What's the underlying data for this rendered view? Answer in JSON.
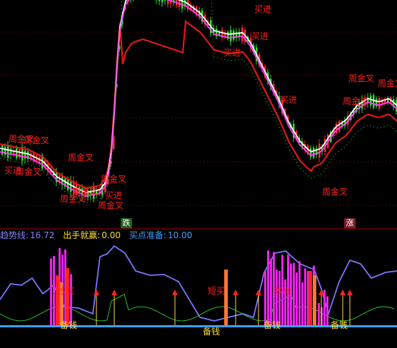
{
  "markers": {
    "down": "跌",
    "up": "涨"
  },
  "main_labels": [
    {
      "text": "周金叉",
      "cls": "sig-red",
      "id": "label-wk-cross-1"
    },
    {
      "text": "周金叉",
      "cls": "sig-red",
      "id": "label-wk-cross-2"
    },
    {
      "text": "买进",
      "cls": "sig-red",
      "id": "label-buy-1"
    },
    {
      "text": "周金叉",
      "cls": "sig-red",
      "id": "label-wk-cross-3"
    },
    {
      "text": "周金叉",
      "cls": "sig-red",
      "id": "label-wk-cross-4"
    },
    {
      "text": "周金叉",
      "cls": "sig-red",
      "id": "label-wk-cross-5"
    },
    {
      "text": "周金叉",
      "cls": "sig-red",
      "id": "label-wk-cross-6"
    },
    {
      "text": "周金叉",
      "cls": "sig-red",
      "id": "label-wk-cross-7"
    },
    {
      "text": "买进",
      "cls": "sig-red",
      "id": "label-buy-2"
    },
    {
      "text": "周金叉",
      "cls": "sig-red",
      "id": "label-wk-cross-8"
    },
    {
      "text": "买进",
      "cls": "sig-red",
      "id": "label-buy-3"
    },
    {
      "text": "买进",
      "cls": "sig-red",
      "id": "label-buy-4"
    },
    {
      "text": "买进",
      "cls": "sig-red",
      "id": "label-buy-5"
    },
    {
      "text": "买进",
      "cls": "sig-red",
      "id": "label-buy-6"
    },
    {
      "text": "周金叉",
      "cls": "sig-red",
      "id": "label-wk-cross-9"
    },
    {
      "text": "周金叉",
      "cls": "sig-red",
      "id": "label-wk-cross-10"
    },
    {
      "text": "周金叉",
      "cls": "sig-red",
      "id": "label-wk-cross-11"
    },
    {
      "text": "周金叉",
      "cls": "sig-red",
      "id": "label-wk-cross-12"
    }
  ],
  "indicator": {
    "name": "趋势线:",
    "trend_value": "16.72",
    "exit_label": "出手就赢:",
    "exit_value": "0.00",
    "prep_label": "买点准备:",
    "prep_value": "10.00"
  },
  "sub_labels": [
    {
      "text": "抄底",
      "cls": "sig-red",
      "id": "label-bottom-1"
    },
    {
      "text": "短买",
      "cls": "sig-red",
      "id": "label-short-buy"
    },
    {
      "text": "抄底",
      "cls": "sig-red",
      "id": "label-bottom-2"
    },
    {
      "text": "备钱",
      "cls": "sig-yellow",
      "id": "label-prep-1"
    },
    {
      "text": "备钱",
      "cls": "sig-yellow",
      "id": "label-prep-2"
    },
    {
      "text": "备钱",
      "cls": "sig-yellow",
      "id": "label-prep-3"
    },
    {
      "text": "备钱",
      "cls": "sig-yellow",
      "id": "label-prep-4"
    }
  ],
  "colors": {
    "up": "#ff2a2a",
    "down": "#33dd33",
    "ma_red": "#e01818",
    "ma_white": "#ffffff",
    "ma_purple": "#ff44ff",
    "dots": "#22cc22",
    "trend": "#7777ff",
    "baseline": "#3aa0ff",
    "thin_green": "#33ee33",
    "yellow": "#ffdd33",
    "orange": "#ff7733",
    "magenta": "#ee22ee",
    "separator": "#aa0000"
  }
}
